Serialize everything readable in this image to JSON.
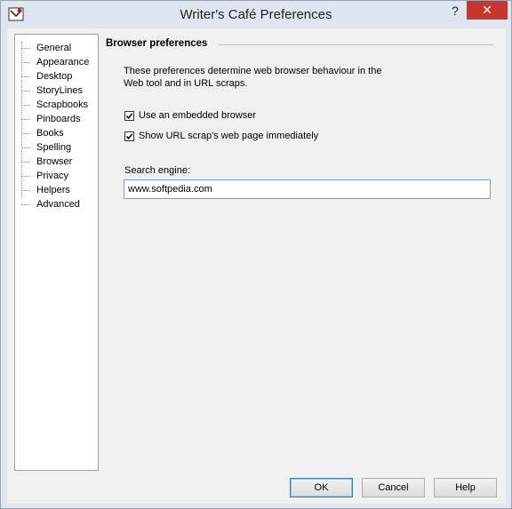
{
  "window": {
    "title": "Writer's Café Preferences",
    "help_glyph": "?",
    "close_glyph": "✕"
  },
  "sidebar": {
    "items": [
      {
        "label": "General"
      },
      {
        "label": "Appearance"
      },
      {
        "label": "Desktop"
      },
      {
        "label": "StoryLines"
      },
      {
        "label": "Scrapbooks"
      },
      {
        "label": "Pinboards"
      },
      {
        "label": "Books"
      },
      {
        "label": "Spelling"
      },
      {
        "label": "Browser"
      },
      {
        "label": "Privacy"
      },
      {
        "label": "Helpers"
      },
      {
        "label": "Advanced"
      }
    ]
  },
  "panel": {
    "title": "Browser preferences",
    "description": "These preferences determine web browser behaviour in the Web tool and in URL scraps.",
    "options": [
      {
        "label": "Use an embedded browser",
        "checked": true
      },
      {
        "label": "Show URL scrap's web page immediately",
        "checked": true
      }
    ],
    "search_engine_label": "Search engine:",
    "search_engine_value": "www.softpedia.com"
  },
  "buttons": {
    "ok": "OK",
    "cancel": "Cancel",
    "help": "Help"
  },
  "colors": {
    "close_red": "#c7372f",
    "frame": "#dfe6ef",
    "input_border": "#7a9cd3"
  }
}
